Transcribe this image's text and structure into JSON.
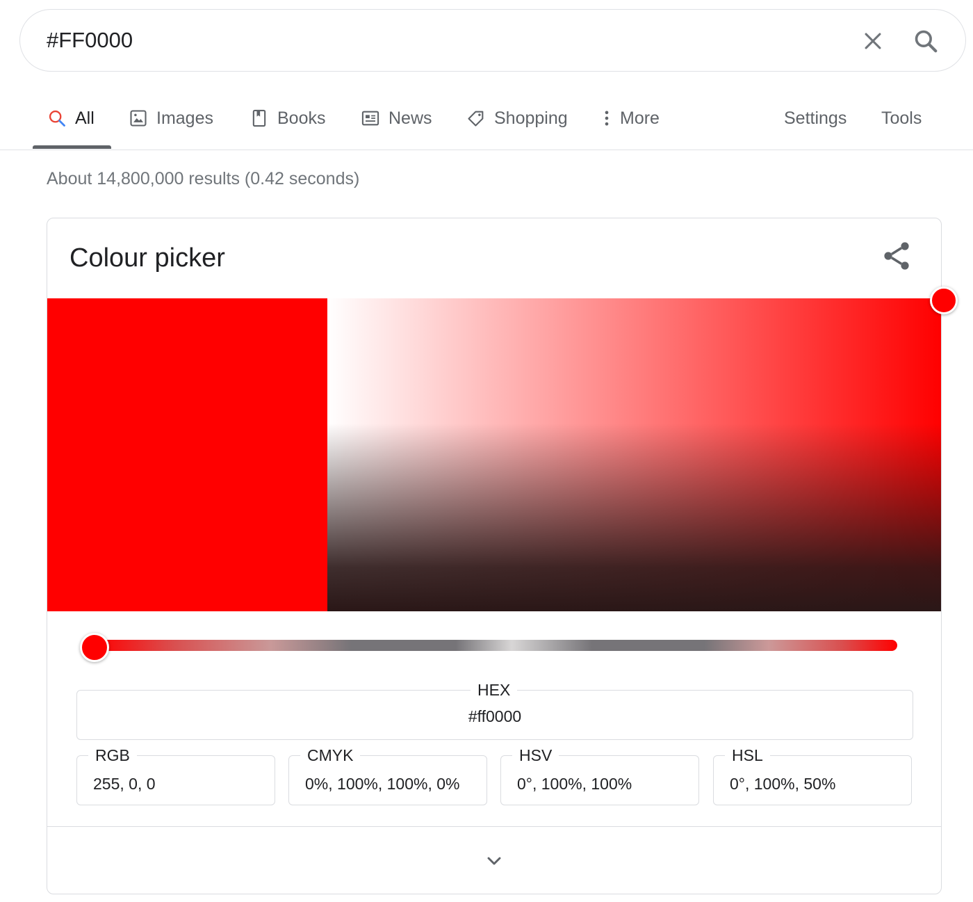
{
  "search": {
    "query": "#FF0000",
    "clear_icon": "close-icon",
    "search_icon": "magnifier-icon"
  },
  "tabs": [
    {
      "label": "All",
      "icon": "search-icon",
      "active": true
    },
    {
      "label": "Images",
      "icon": "image-icon"
    },
    {
      "label": "Books",
      "icon": "book-icon"
    },
    {
      "label": "News",
      "icon": "news-icon"
    },
    {
      "label": "Shopping",
      "icon": "tag-icon"
    },
    {
      "label": "More",
      "icon": "vertical-dots-icon"
    },
    {
      "label": "Settings"
    },
    {
      "label": "Tools"
    }
  ],
  "result_stats": "About 14,800,000 results (0.42 seconds)",
  "colour_picker": {
    "title": "Colour picker",
    "selected_color": "#ff0000",
    "hue_position": 0,
    "saturation": 1.0,
    "value": 1.0,
    "hex": {
      "label": "HEX",
      "value": "#ff0000"
    },
    "rgb": {
      "label": "RGB",
      "value": "255, 0, 0"
    },
    "cmyk": {
      "label": "CMYK",
      "value": "0%, 100%, 100%, 0%"
    },
    "hsv": {
      "label": "HSV",
      "value": "0°, 100%, 100%"
    },
    "hsl": {
      "label": "HSL",
      "value": "0°, 100%, 50%"
    }
  },
  "colors": {
    "accent_red": "#ff0000",
    "text": "#202124",
    "muted": "#5f6368",
    "border": "#dadce0"
  }
}
